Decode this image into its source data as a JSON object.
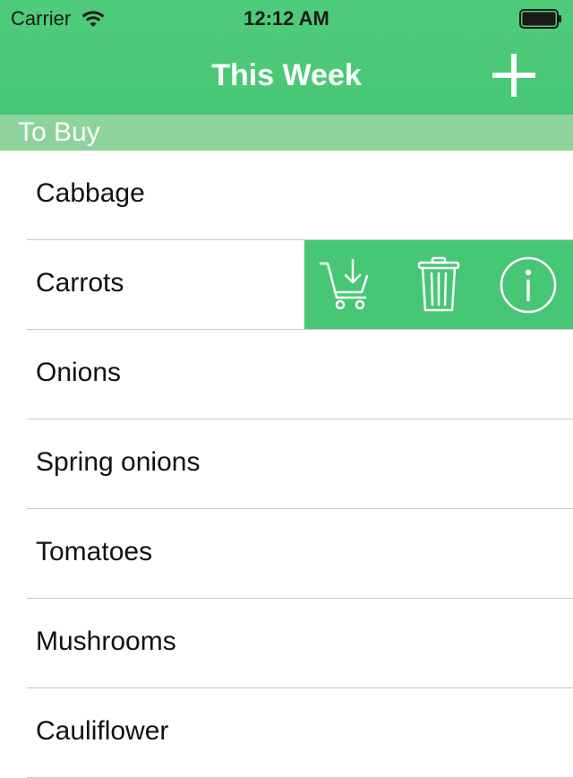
{
  "status_bar": {
    "carrier": "Carrier",
    "time": "12:12 AM",
    "icons": [
      "wifi-icon",
      "battery-icon"
    ]
  },
  "nav": {
    "title": "This Week",
    "add_icon": "plus-icon"
  },
  "section": {
    "title": "To Buy"
  },
  "items": [
    {
      "label": "Cabbage"
    },
    {
      "label": "Carrots"
    },
    {
      "label": "Onions"
    },
    {
      "label": "Spring onions"
    },
    {
      "label": "Tomatoes"
    },
    {
      "label": "Mushrooms"
    },
    {
      "label": "Cauliflower"
    }
  ],
  "swipe_actions": {
    "row_label": "Carrots",
    "actions": [
      "cart-move-icon",
      "trash-icon",
      "info-icon"
    ]
  },
  "colors": {
    "header": "#47c775",
    "section_header": "#8dd39b",
    "accent": "#ffffff"
  }
}
